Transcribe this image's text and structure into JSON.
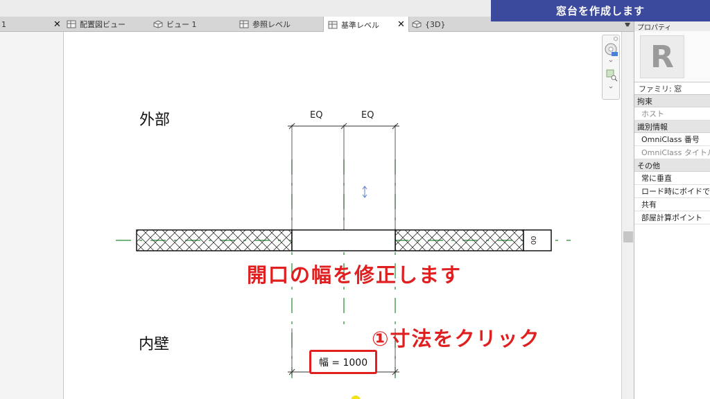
{
  "banner": {
    "text": "窓台を作成します"
  },
  "tabs": [
    {
      "label": "1",
      "close": "✕"
    },
    {
      "label": "配置図ビュー"
    },
    {
      "label": "ビュー 1"
    },
    {
      "label": "参照レベル"
    },
    {
      "label": "基準レベル",
      "close": "✕",
      "active": true
    },
    {
      "label": "{3D}"
    }
  ],
  "properties": {
    "title": "プロパティ",
    "logo": "R",
    "family": "ファミリ: 窓",
    "categories": [
      {
        "name": "拘束",
        "rows": [
          {
            "label": "ホスト",
            "muted": true
          }
        ]
      },
      {
        "name": "識別情報",
        "rows": [
          {
            "label": "OmniClass 番号"
          },
          {
            "label": "OmniClass タイトル",
            "muted": true
          }
        ]
      },
      {
        "name": "その他",
        "rows": [
          {
            "label": "常に垂直"
          },
          {
            "label": "ロード時にボイドで切り"
          },
          {
            "label": "共有"
          },
          {
            "label": "部屋計算ポイント"
          }
        ]
      }
    ]
  },
  "canvas": {
    "exterior_label": "外部",
    "interior_label": "内壁",
    "eq_left": "EQ",
    "eq_right": "EQ",
    "width_dimension": "幅 = 1000",
    "wall_marker": "00"
  },
  "annotations": {
    "instruction_main": "開口の幅を修正します",
    "instruction_step": "①寸法をクリック"
  },
  "colors": {
    "banner": "#3b4a9c",
    "annotation_red": "#e02020",
    "reference_green": "#1f8a2e"
  }
}
